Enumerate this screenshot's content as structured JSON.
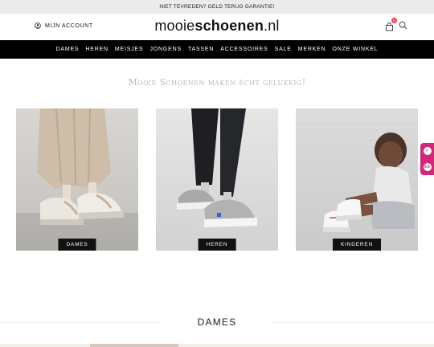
{
  "topbar": {
    "promo": "NIET TEVREDEN? GELD TERUG GARANTIE!"
  },
  "header": {
    "account_label": "MIJN ACCOUNT",
    "logo_regular_1": "mooie",
    "logo_bold": "schoenen",
    "logo_regular_2": ".nl",
    "cart_count": "0"
  },
  "nav": {
    "items": [
      {
        "label": "DAMES"
      },
      {
        "label": "HEREN"
      },
      {
        "label": "MEISJES"
      },
      {
        "label": "JONGENS"
      },
      {
        "label": "TASSEN"
      },
      {
        "label": "ACCESSOIRES"
      },
      {
        "label": "SALE"
      },
      {
        "label": "MERKEN"
      },
      {
        "label": "ONZE WINKEL"
      }
    ]
  },
  "hero": {
    "tagline": "Mooie Schoenen maken écht gelukkig!",
    "tiles": [
      {
        "label": "DAMES"
      },
      {
        "label": "HEREN"
      },
      {
        "label": "KINDEREN"
      }
    ]
  },
  "side_badge": {
    "rating": "9.6"
  },
  "section": {
    "title": "DAMES"
  },
  "colors": {
    "nav_bg": "#000000",
    "topbar_bg": "#ebebeb",
    "accent": "#d2287a",
    "cart_badge": "#e8474c"
  }
}
